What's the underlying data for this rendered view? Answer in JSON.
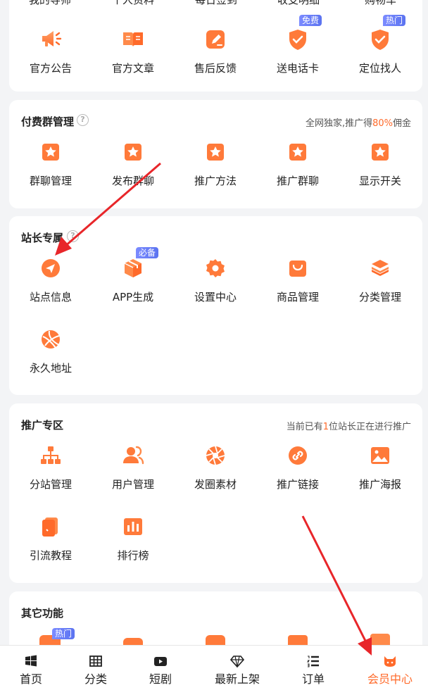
{
  "top_section": {
    "cut_labels": [
      "我的导师",
      "个人资料",
      "每日签到",
      "收支明细",
      "购物车"
    ],
    "items": [
      {
        "label": "官方公告",
        "icon": "megaphone-icon"
      },
      {
        "label": "官方文章",
        "icon": "book-icon"
      },
      {
        "label": "售后反馈",
        "icon": "edit-icon"
      },
      {
        "label": "送电话卡",
        "icon": "shield-check-icon",
        "badge": "免费"
      },
      {
        "label": "定位找人",
        "icon": "shield-check-icon",
        "badge": "热门"
      }
    ]
  },
  "paid_group": {
    "title": "付费群管理",
    "note_prefix": "全网独家,推广得",
    "note_highlight": "80%",
    "note_suffix": "佣金",
    "items": [
      {
        "label": "群聊管理",
        "icon": "star-box-icon"
      },
      {
        "label": "发布群聊",
        "icon": "star-box-icon"
      },
      {
        "label": "推广方法",
        "icon": "star-box-icon"
      },
      {
        "label": "推广群聊",
        "icon": "star-box-icon"
      },
      {
        "label": "显示开关",
        "icon": "star-box-icon"
      }
    ]
  },
  "station": {
    "title": "站长专属",
    "items": [
      {
        "label": "站点信息",
        "icon": "navigation-icon"
      },
      {
        "label": "APP生成",
        "icon": "box-icon",
        "badge": "必备"
      },
      {
        "label": "设置中心",
        "icon": "settings-gear-icon"
      },
      {
        "label": "商品管理",
        "icon": "shopping-bag-icon"
      },
      {
        "label": "分类管理",
        "icon": "layers-icon"
      },
      {
        "label": "永久地址",
        "icon": "globe-icon"
      }
    ]
  },
  "promotion": {
    "title": "推广专区",
    "note_prefix": "当前已有",
    "note_highlight": "1",
    "note_suffix": "位站长正在进行推广",
    "items": [
      {
        "label": "分站管理",
        "icon": "sitemap-icon"
      },
      {
        "label": "用户管理",
        "icon": "users-icon"
      },
      {
        "label": "发圈素材",
        "icon": "aperture-icon"
      },
      {
        "label": "推广链接",
        "icon": "link-icon"
      },
      {
        "label": "推广海报",
        "icon": "image-icon"
      },
      {
        "label": "引流教程",
        "icon": "document-icon"
      },
      {
        "label": "排行榜",
        "icon": "bar-chart-icon"
      }
    ]
  },
  "other": {
    "title": "其它功能",
    "badge": "热门"
  },
  "tabbar": {
    "tabs": [
      {
        "label": "首页",
        "icon": "windows-icon"
      },
      {
        "label": "分类",
        "icon": "grid-icon"
      },
      {
        "label": "短剧",
        "icon": "play-icon"
      },
      {
        "label": "最新上架",
        "icon": "diamond-icon"
      },
      {
        "label": "订单",
        "icon": "list-icon"
      },
      {
        "label": "会员中心",
        "icon": "cat-icon"
      }
    ],
    "active_color": "#ff6a2a"
  },
  "colors": {
    "accent": "#ff6a2a",
    "annotation_arrow": "#e8262a",
    "badge": "#6b80f5"
  }
}
